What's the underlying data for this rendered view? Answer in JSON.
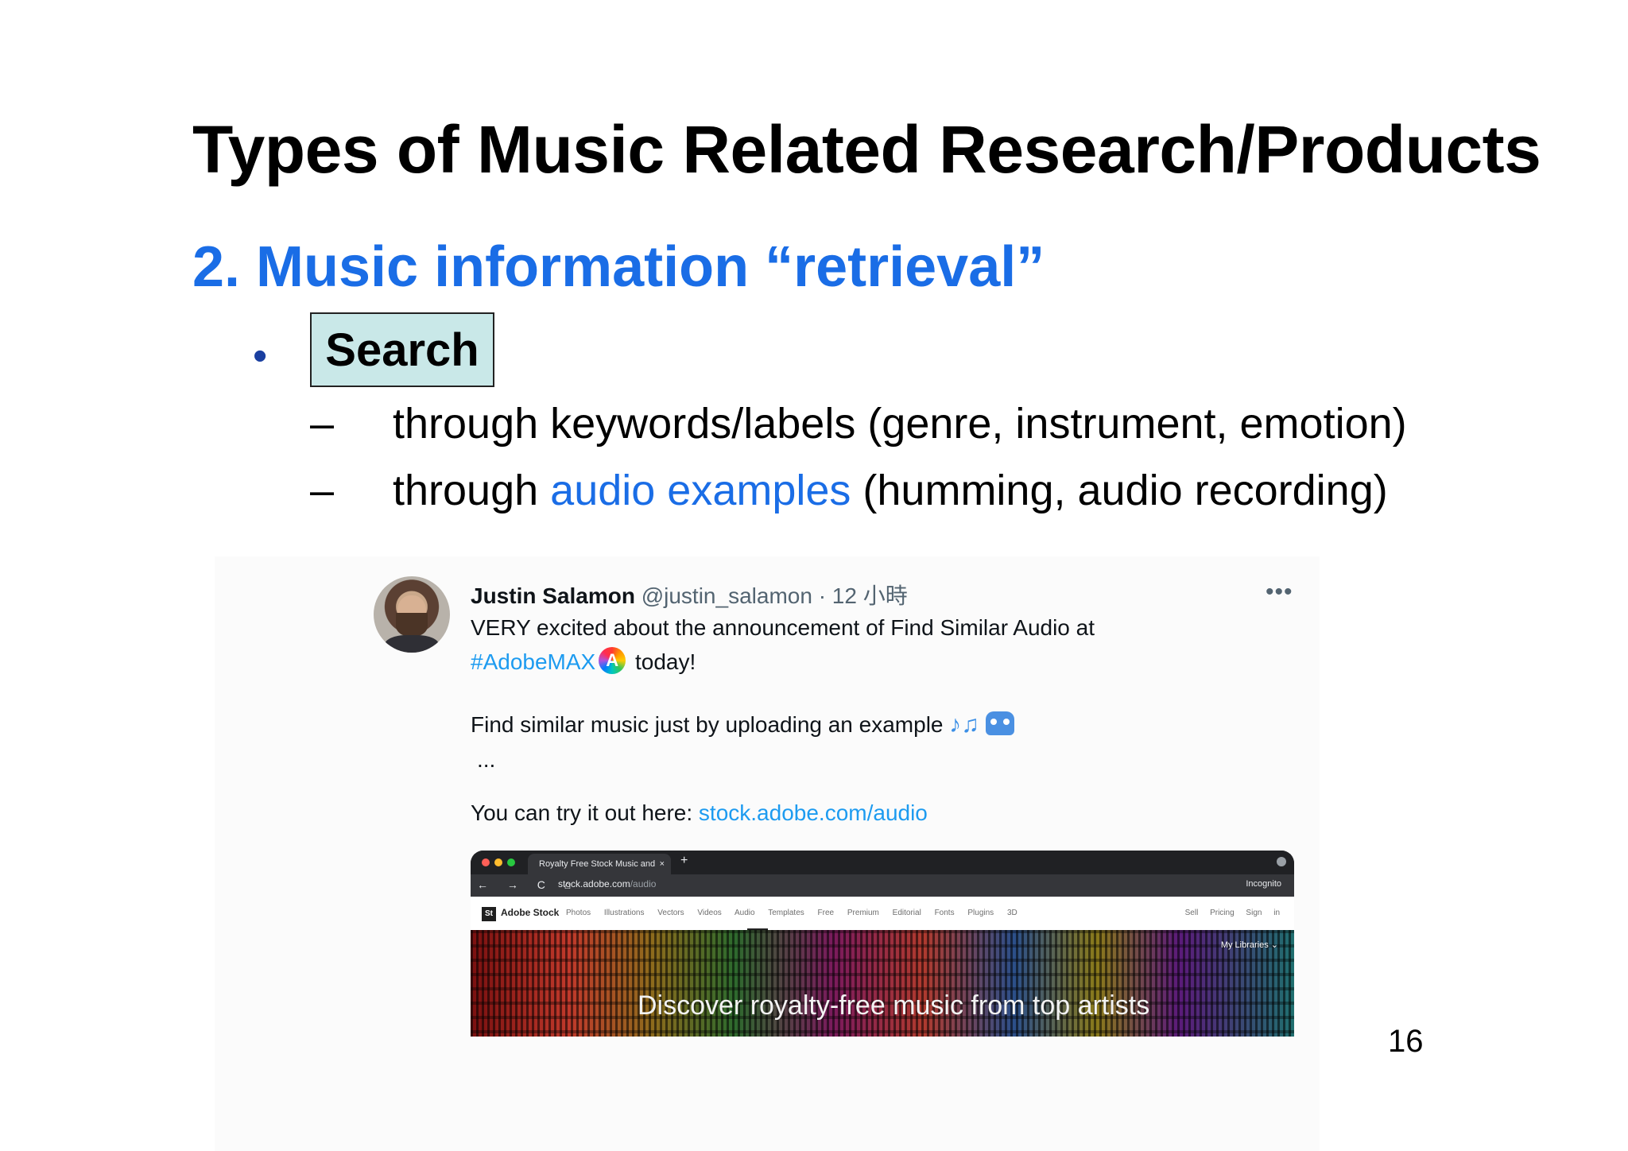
{
  "slide": {
    "title": "Types of Music Related Research/Products",
    "section_heading": "2. Music information “retrieval”",
    "bullet": "•",
    "bullet_label": "Search",
    "sub_dash": "–",
    "sub1": "through keywords/labels (genre, instrument, emotion)",
    "sub2_prefix": "through ",
    "sub2_link": "audio examples",
    "sub2_suffix": " (humming, audio recording)",
    "page_number": "16"
  },
  "tweet": {
    "author_name": "Justin Salamon",
    "handle_time": " @justin_salamon · 12 小時",
    "more": "•••",
    "line1": "VERY excited about the announcement of Find Similar Audio at",
    "hashtag": "#AdobeMAX",
    "line2_after": " today!",
    "line3": "Find similar music just by uploading an example ",
    "music_emoji": "♪♫",
    "ellipsis": "...",
    "line5_prefix": "You can try it out here: ",
    "line5_link": "stock.adobe.com/audio"
  },
  "browser": {
    "tab_title": "Royalty Free Stock Music and",
    "tab_close": "×",
    "tab_plus": "+",
    "nav_icons": "← → C ⌂",
    "url_host": "stock.adobe.com",
    "url_path": "/audio",
    "incognito": "Incognito",
    "brand_logo": "St",
    "brand_name": "Adobe Stock",
    "nav_links": "Photos Illustrations Vectors Videos Audio Templates Free Premium Editorial Fonts Plugins 3D",
    "nav_right": "Sell Pricing Sign in",
    "my_libraries": "My Libraries ⌄",
    "hero_text": "Discover royalty-free music from top artists"
  },
  "colors": {
    "heading_blue": "#1a6de6",
    "search_box_fill": "#c9e8e8",
    "twitter_link": "#1d9bf0"
  }
}
